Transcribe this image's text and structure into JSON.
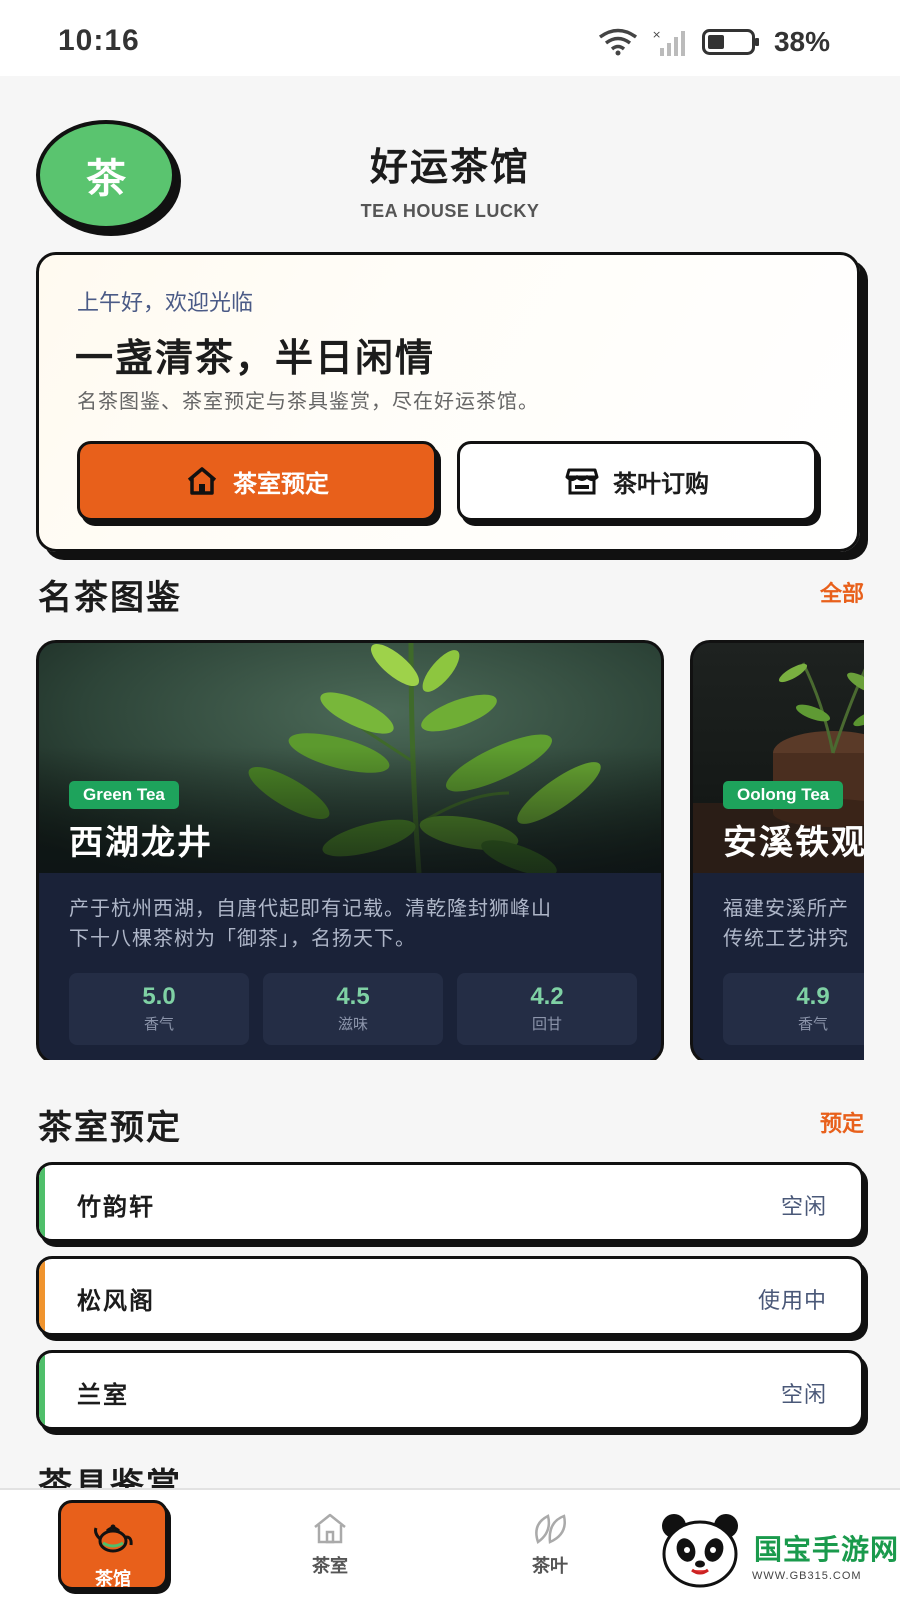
{
  "status_bar": {
    "time": "10:16",
    "battery_percent": "38%"
  },
  "header": {
    "logo_char": "茶",
    "title": "好运茶馆",
    "subtitle": "TEA HOUSE LUCKY"
  },
  "hero": {
    "greeting": "上午好，欢迎光临",
    "title": "一盏清茶，半日闲情",
    "description": "名茶图鉴、茶室预定与茶具鉴赏，尽在好运茶馆。",
    "buttons": [
      {
        "label": "茶室预定",
        "icon": "home-icon"
      },
      {
        "label": "茶叶订购",
        "icon": "store-icon"
      }
    ]
  },
  "sections": {
    "teas": {
      "title": "名茶图鉴",
      "link": "全部"
    },
    "rooms": {
      "title": "茶室预定",
      "link": "预定"
    },
    "teaware": {
      "title": "茶具鉴赏"
    }
  },
  "teas": [
    {
      "badge": "Green Tea",
      "name": "西湖龙井",
      "description_lines": [
        "产于杭州西湖，自唐代起即有记载。清乾隆封狮峰山",
        "下十八棵茶树为「御茶」，名扬天下。"
      ],
      "stats": [
        {
          "value": "5.0",
          "label": "香气"
        },
        {
          "value": "4.5",
          "label": "滋味"
        },
        {
          "value": "4.2",
          "label": "回甘"
        }
      ]
    },
    {
      "badge": "Oolong Tea",
      "name": "安溪铁观",
      "description_lines": [
        "福建安溪所产",
        "传统工艺讲究"
      ],
      "stats": [
        {
          "value": "4.9",
          "label": "香气"
        }
      ]
    }
  ],
  "rooms": [
    {
      "name": "竹韵轩",
      "status": "空闲",
      "accent": "#4fbf6a"
    },
    {
      "name": "松风阁",
      "status": "使用中",
      "accent": "#f0942e"
    },
    {
      "name": "兰室",
      "status": "空闲",
      "accent": "#4fbf6a"
    }
  ],
  "tabbar": [
    {
      "label": "茶馆",
      "icon": "teapot-icon",
      "active": true
    },
    {
      "label": "茶室",
      "icon": "home-icon",
      "active": false
    },
    {
      "label": "茶叶",
      "icon": "leaf-icon",
      "active": false
    }
  ],
  "watermark": {
    "text": "国宝手游网",
    "url": "WWW.GB315.COM"
  },
  "colors": {
    "accent": "#e8601b",
    "green": "#5ac46f",
    "card_dark": "#1a2238"
  }
}
